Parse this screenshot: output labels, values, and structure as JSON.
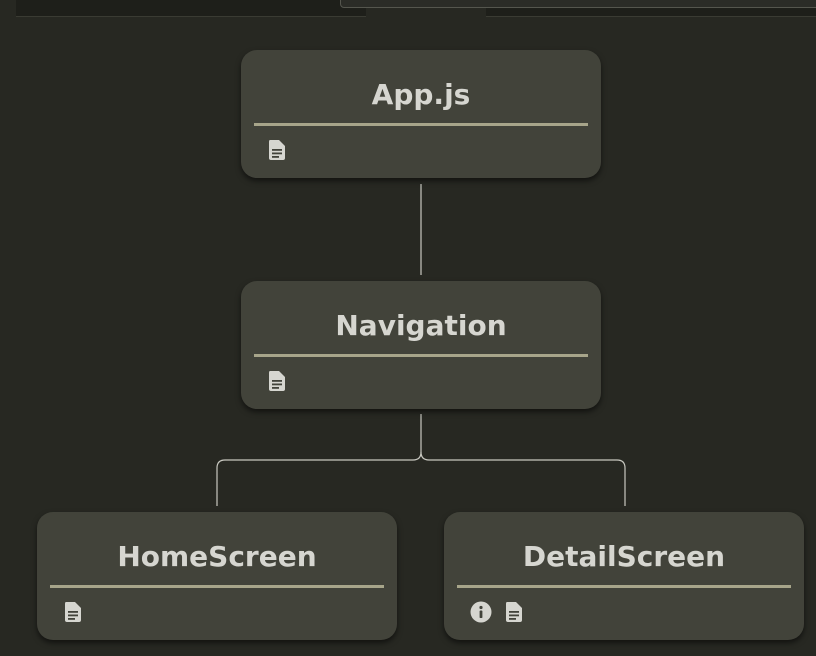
{
  "diagram": {
    "nodes": [
      {
        "id": "app",
        "title": "App.js",
        "icons": [
          "document-icon"
        ]
      },
      {
        "id": "nav",
        "title": "Navigation",
        "icons": [
          "document-icon"
        ]
      },
      {
        "id": "home",
        "title": "HomeScreen",
        "icons": [
          "document-icon"
        ]
      },
      {
        "id": "detail",
        "title": "DetailScreen",
        "icons": [
          "info-icon",
          "document-icon"
        ]
      }
    ],
    "edges": [
      {
        "from": "App.js",
        "to": "Navigation"
      },
      {
        "from": "Navigation",
        "to": "HomeScreen"
      },
      {
        "from": "Navigation",
        "to": "DetailScreen"
      }
    ]
  },
  "colors": {
    "background": "#272822",
    "node": "#42433a",
    "title": "#d6d6d0",
    "divider": "#a7a58a",
    "connector": "#c8c8c0"
  }
}
